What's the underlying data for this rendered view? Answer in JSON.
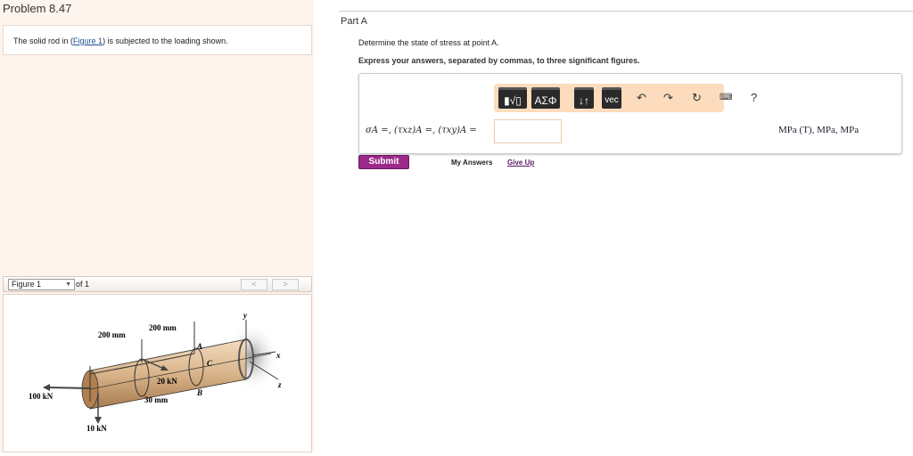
{
  "problem": {
    "title": "Problem 8.47",
    "statement_pre": "The solid rod in (",
    "figure_link": "Figure 1",
    "statement_post": ") is subjected to the loading shown."
  },
  "figure_nav": {
    "selected": "Figure 1",
    "of": "of 1",
    "prev": "<",
    "next": ">"
  },
  "figure": {
    "labels": {
      "d1": "200 mm",
      "d2": "200 mm",
      "A": "A",
      "B": "B",
      "C": "C",
      "x": "x",
      "y": "y",
      "z": "z",
      "f1": "100 kN",
      "f2": "10 kN",
      "f3": "20 kN",
      "r": "30 mm"
    }
  },
  "part": {
    "title": "Part A",
    "question": "Determine the state of stress at point A.",
    "instruction": "Express your answers, separated by commas, to three significant figures."
  },
  "toolbar": {
    "templates": "▮√▯",
    "greek": "ΑΣΦ",
    "arrows": "↓↑",
    "vec": "vec",
    "help": "?"
  },
  "answer": {
    "equation": "σA =, (τxz)A =, (τxy)A =",
    "value": "",
    "units": "MPa (T), MPa, MPa"
  },
  "actions": {
    "submit": "Submit",
    "my_answers": "My Answers",
    "give_up": "Give Up"
  },
  "colors": {
    "submit": "#9b2a8a",
    "toolbar": "#fcdcbc",
    "rod": "#d9b48a"
  }
}
